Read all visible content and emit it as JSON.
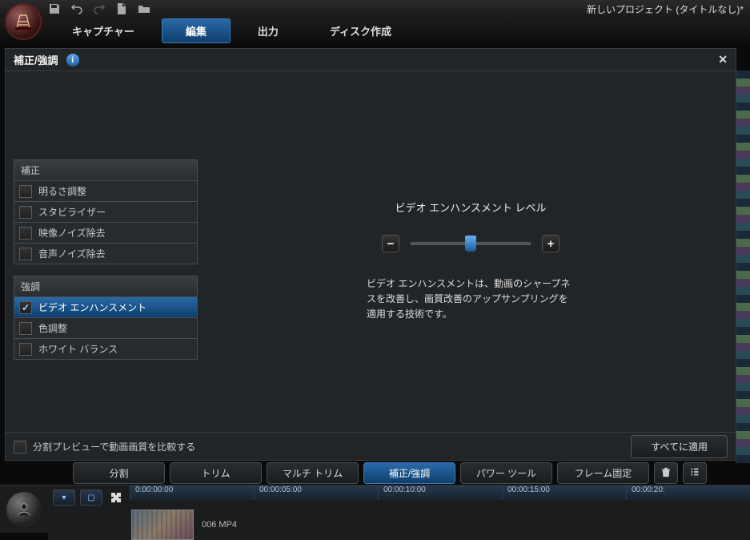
{
  "app": {
    "title": "新しいプロジェクト (タイトルなし)*"
  },
  "modes": {
    "capture": "キャプチャー",
    "edit": "編集",
    "output": "出力",
    "disc": "ディスク作成"
  },
  "panel": {
    "title": "補正/強調"
  },
  "fix": {
    "header": "補正",
    "items": [
      "明るさ調整",
      "スタビライザー",
      "映像ノイズ除去",
      "音声ノイズ除去"
    ]
  },
  "enhance": {
    "header": "強調",
    "items": [
      "ビデオ エンハンスメント",
      "色調整",
      "ホワイト バランス"
    ]
  },
  "detail": {
    "slider_title": "ビデオ エンハンスメント レベル",
    "desc": "ビデオ エンハンスメントは、動画のシャープネスを改善し、画質改善のアップサンプリングを適用する技術です。"
  },
  "footer": {
    "split_preview": "分割プレビューで動画画質を比較する",
    "apply_all": "すべてに適用"
  },
  "clipbar": {
    "split": "分割",
    "trim": "トリム",
    "multi_trim": "マルチ トリム",
    "fix_enhance": "補正/強調",
    "power_tool": "パワー ツール",
    "frame_freeze": "フレーム固定"
  },
  "timeline": {
    "ticks": [
      "0:00:00:00",
      "00:00:05:00",
      "00:00:10:00",
      "00:00:15:00",
      "00:00:20:"
    ],
    "clip_name": "006 MP4"
  }
}
